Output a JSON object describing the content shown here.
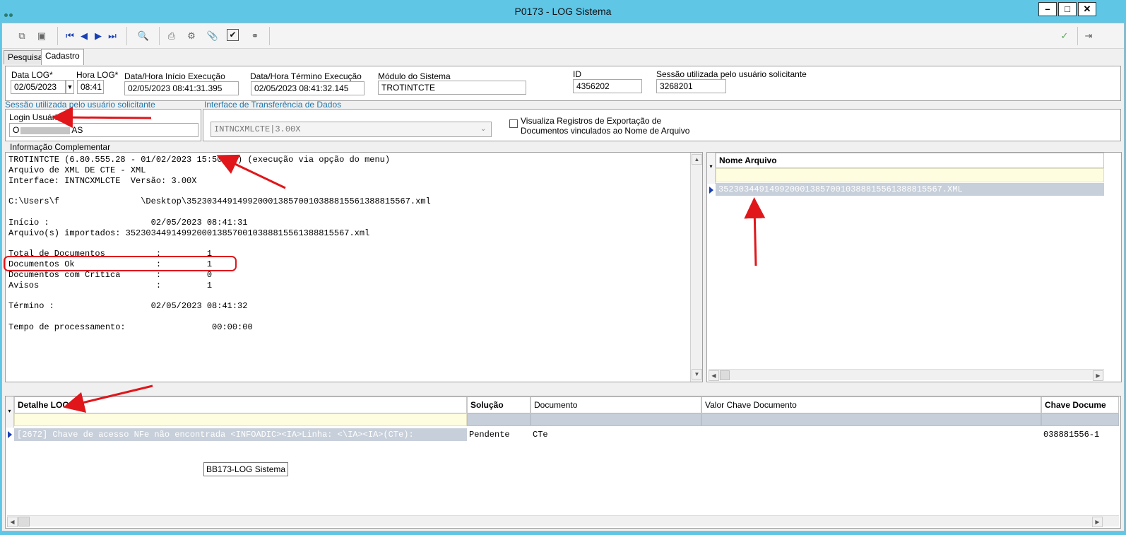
{
  "window": {
    "title": "P0173 - LOG Sistema"
  },
  "tabs": [
    {
      "label": "Pesquisa"
    },
    {
      "label": "Cadastro"
    }
  ],
  "fields": {
    "data_log": {
      "label": "Data LOG*",
      "value": "02/05/2023"
    },
    "hora_log": {
      "label": "Hora LOG*",
      "value": "08:41"
    },
    "inicio": {
      "label": "Data/Hora Início Execução",
      "value": "02/05/2023 08:41:31.395"
    },
    "termino": {
      "label": "Data/Hora Término Execução",
      "value": "02/05/2023 08:41:32.145"
    },
    "modulo": {
      "label": "Módulo do Sistema",
      "value": "TROTINTCTE"
    },
    "id": {
      "label": "ID",
      "value": "4356202"
    },
    "sessao": {
      "label": "Sessão utilizada pelo usuário solicitante",
      "value": "3268201"
    }
  },
  "session_group": {
    "title": "Sessão utilizada pelo usuário solicitante",
    "login_label": "Login Usuário",
    "login_prefix": "O",
    "login_suffix": "AS"
  },
  "interface_group": {
    "title": "Interface de Transferência de Dados",
    "select_value": "INTNCXMLCTE|3.00X",
    "checkbox_label_1": "Visualiza Registros de Exportação de",
    "checkbox_label_2": "Documentos vinculados ao Nome de Arquivo"
  },
  "info": {
    "title": "Informação Complementar",
    "lines": [
      "TROTINTCTE (6.80.555.28 - 01/02/2023 15:50:56) (execução via opção do menu)",
      "Arquivo de XML DE CTE - XML",
      "Interface: INTNCXMLCTE  Versão: 3.00X",
      "",
      "C:\\Users\\f                \\Desktop\\35230344914992000138570010388815561388815567.xml",
      "",
      "Início :                    02/05/2023 08:41:31",
      "Arquivo(s) importados: 35230344914992000138570010388815561388815567.xml",
      "",
      "Total de Documentos          :         1",
      "Documentos Ok                :         1",
      "Documentos com Crítica       :         0",
      "Avisos                       :         1",
      "",
      "Término :                   02/05/2023 08:41:32",
      "",
      "Tempo de processamento:                 00:00:00"
    ]
  },
  "file_grid": {
    "header": "Nome Arquivo",
    "row": "35230344914992000138570010388815561388815567.XML"
  },
  "log_grid": {
    "headers": [
      "Detalhe LOG",
      "Solução",
      "Documento",
      "Valor Chave Documento",
      "Chave Docume"
    ],
    "row": {
      "detalhe": "[2672] Chave de acesso NFe não encontrada <INFOADIC><IA>Linha:      <\\IA><IA>(CTe):",
      "solucao": "Pendente",
      "documento": "CTe",
      "valor": "",
      "chave": "038881556-1"
    }
  },
  "tooltip": "BB173-LOG Sistema",
  "colors": {
    "titlebar": "#5fc6e6",
    "accent_red": "#e0161b",
    "group_title": "#2277aa"
  }
}
